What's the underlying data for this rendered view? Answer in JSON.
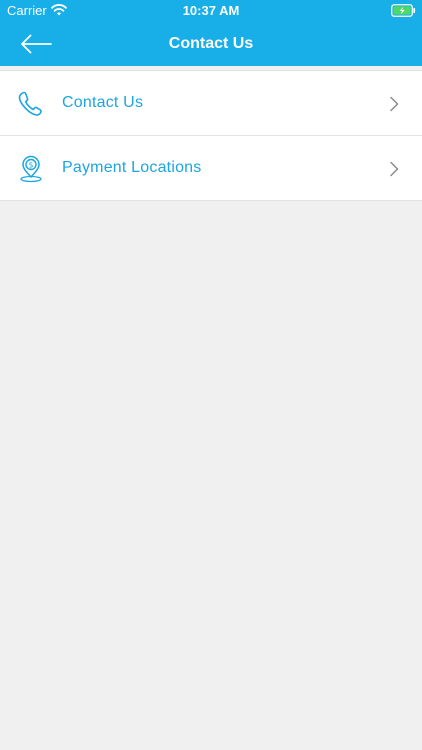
{
  "status_bar": {
    "carrier": "Carrier",
    "time": "10:37 AM",
    "wifi_icon": "wifi-icon",
    "battery_icon": "battery-charging-icon"
  },
  "nav": {
    "title": "Contact Us",
    "back_icon": "arrow-left-icon"
  },
  "menu": {
    "items": [
      {
        "label": "Contact Us",
        "icon": "phone-icon"
      },
      {
        "label": "Payment Locations",
        "icon": "dollar-location-pin-icon"
      }
    ]
  },
  "colors": {
    "primary": "#18aee8",
    "accent_text": "#1ba6df",
    "background": "#f0f0f0",
    "surface": "#ffffff",
    "chevron": "#8c8c8c"
  }
}
